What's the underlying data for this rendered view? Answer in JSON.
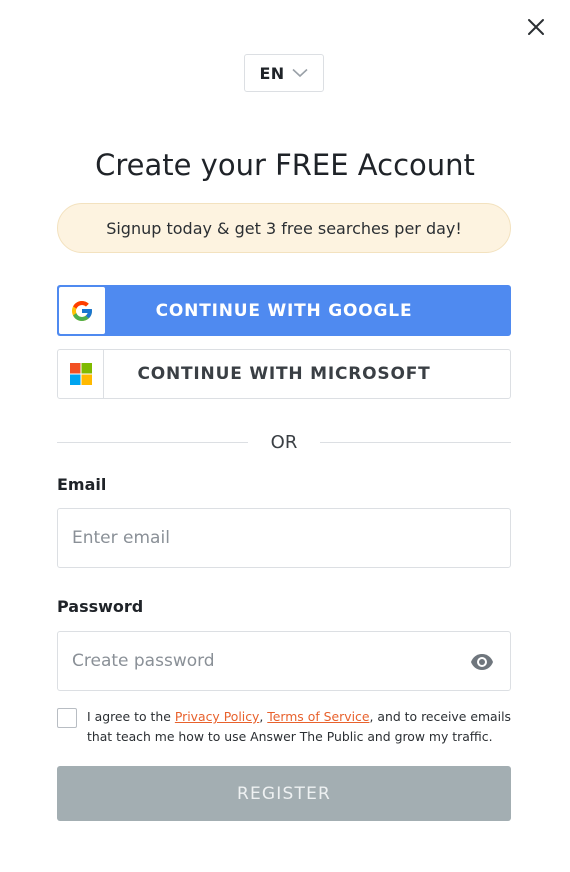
{
  "header": {
    "language": "EN"
  },
  "title": "Create your FREE Account",
  "promo": "Signup today & get 3 free searches per day!",
  "sso": {
    "google_label": "CONTINUE WITH GOOGLE",
    "microsoft_label": "CONTINUE WITH MICROSOFT"
  },
  "divider": "OR",
  "email": {
    "label": "Email",
    "placeholder": "Enter email"
  },
  "password": {
    "label": "Password",
    "placeholder": "Create password"
  },
  "agreement": {
    "prefix": "I agree to the ",
    "privacy_link": "Privacy Policy",
    "separator": ", ",
    "terms_link": "Terms of Service",
    "suffix": ", and to receive emails that teach me how to use Answer The Public and grow my traffic."
  },
  "register_label": "REGISTER",
  "icons": {
    "close": "close-icon",
    "language_dropdown": "chevron-down-icon",
    "google": "google-logo-icon",
    "microsoft": "microsoft-logo-icon",
    "password_visibility": "eye-icon"
  },
  "colors": {
    "google_button": "#4f8af0",
    "promo_background": "#fdf3e0",
    "link": "#e8612c",
    "register_button": "#a3aeb2"
  }
}
